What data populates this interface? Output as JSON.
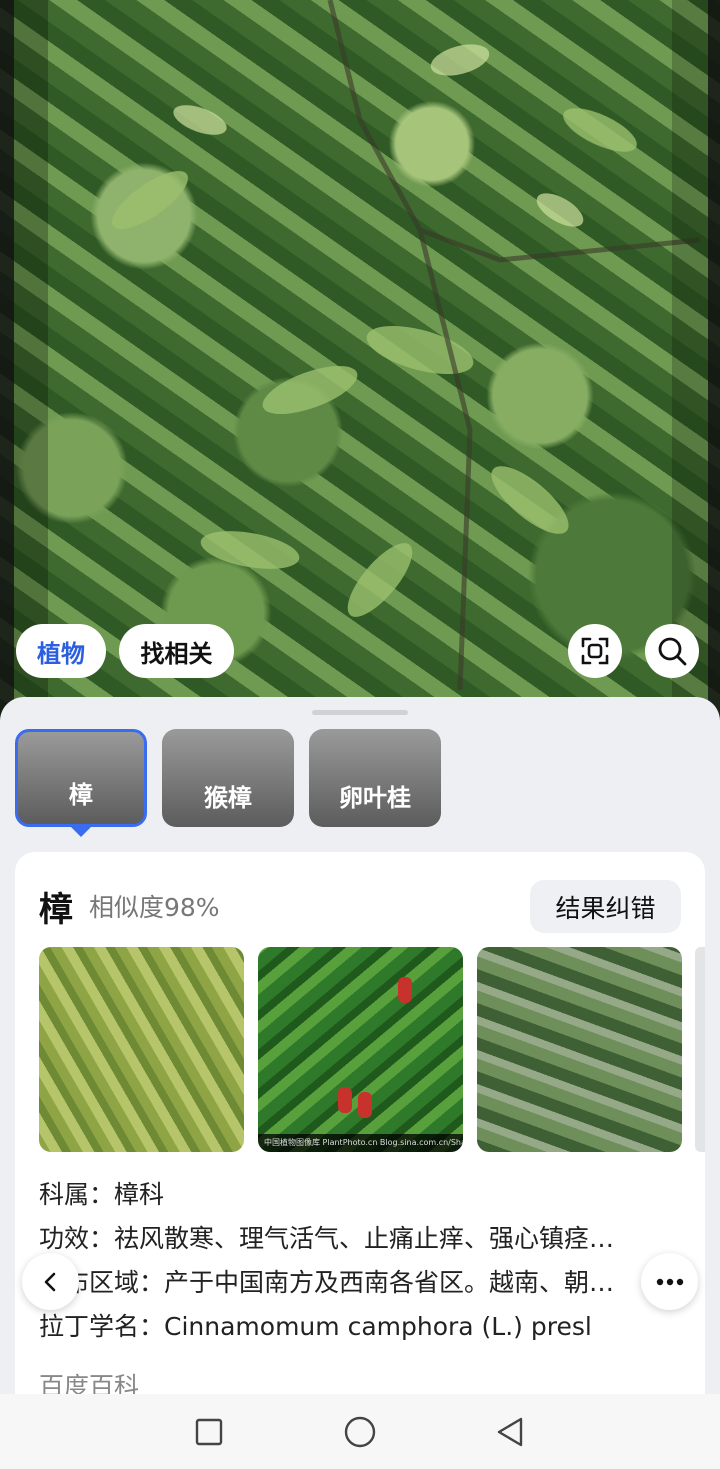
{
  "photo": {
    "description_icon": "plant-photo"
  },
  "chips": {
    "category": "植物",
    "related": "找相关"
  },
  "candidates": [
    {
      "label": "樟"
    },
    {
      "label": "猴樟"
    },
    {
      "label": "卵叶桂"
    }
  ],
  "result": {
    "name": "樟",
    "similarity": "相似度98%",
    "fix_button": "结果纠错",
    "thumbnail_caption": "中国植物图像库 PlantPhoto.cn Blog.sina.com.cn/Sharkhans",
    "info": [
      {
        "label": "科属：",
        "value": "樟科"
      },
      {
        "label": "功效：",
        "value": "祛风散寒、理气活气、止痛止痒、强心镇痉…"
      },
      {
        "label": "分布区域：",
        "value": "产于中国南方及西南各省区。越南、朝…"
      },
      {
        "label": "拉丁学名：",
        "value": "Cinnamomum camphora (L.) presl"
      }
    ],
    "source": "百度百科"
  },
  "colors": {
    "accent": "#3a6cf0",
    "sheet_bg": "#eeeff3"
  }
}
